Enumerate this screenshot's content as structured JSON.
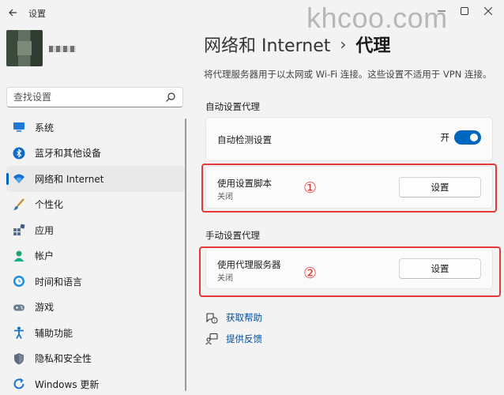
{
  "window": {
    "title": "设置",
    "watermark": "khcoo.com"
  },
  "sidebar": {
    "search_placeholder": "查找设置",
    "items": [
      {
        "label": "系统",
        "icon": "monitor-icon"
      },
      {
        "label": "蓝牙和其他设备",
        "icon": "bluetooth-icon"
      },
      {
        "label": "网络和 Internet",
        "icon": "wifi-icon",
        "active": true
      },
      {
        "label": "个性化",
        "icon": "brush-icon"
      },
      {
        "label": "应用",
        "icon": "apps-icon"
      },
      {
        "label": "帐户",
        "icon": "person-icon"
      },
      {
        "label": "时间和语言",
        "icon": "globe-clock-icon"
      },
      {
        "label": "游戏",
        "icon": "gamepad-icon"
      },
      {
        "label": "辅助功能",
        "icon": "accessibility-icon"
      },
      {
        "label": "隐私和安全性",
        "icon": "shield-icon"
      },
      {
        "label": "Windows 更新",
        "icon": "update-icon"
      }
    ]
  },
  "header": {
    "parent": "网络和 Internet",
    "separator": "›",
    "current": "代理"
  },
  "description": "将代理服务器用于以太网或 Wi-Fi 连接。这些设置不适用于 VPN 连接。",
  "auto_section": {
    "title": "自动设置代理",
    "detect": {
      "label": "自动检测设置",
      "toggle_text": "开",
      "on": true
    },
    "script": {
      "label": "使用设置脚本",
      "status": "关闭",
      "button": "设置"
    }
  },
  "manual_section": {
    "title": "手动设置代理",
    "proxy": {
      "label": "使用代理服务器",
      "status": "关闭",
      "button": "设置"
    }
  },
  "annotations": {
    "one": "①",
    "two": "②",
    "color": "#e53939"
  },
  "links": [
    {
      "label": "获取帮助",
      "icon": "help-icon"
    },
    {
      "label": "提供反馈",
      "icon": "feedback-icon"
    }
  ],
  "accent": "#0067c0"
}
